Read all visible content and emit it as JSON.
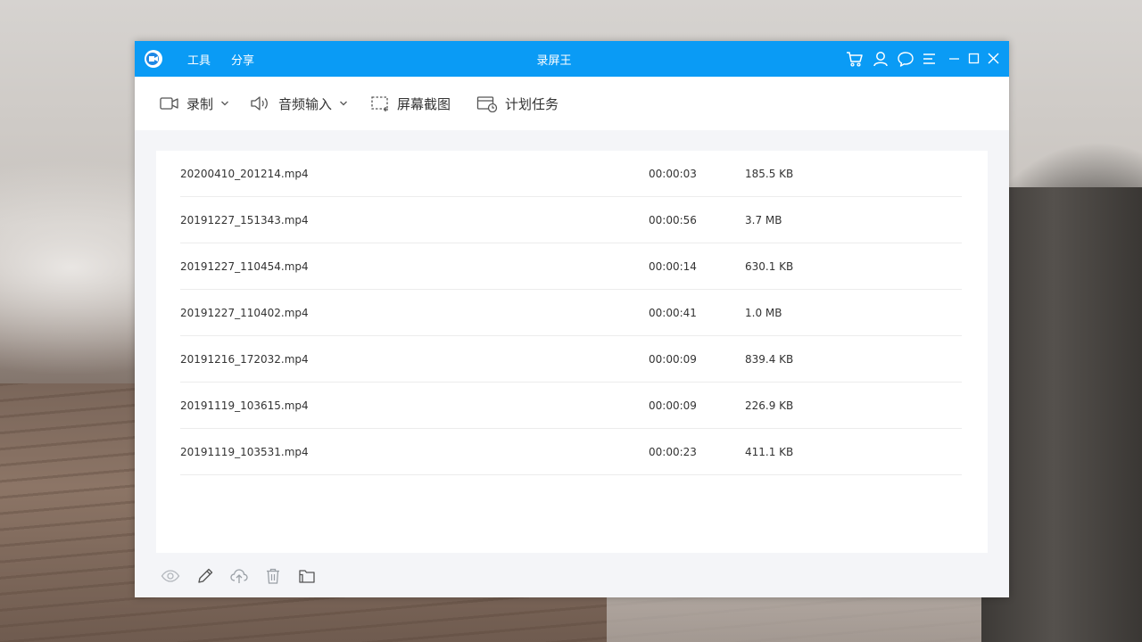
{
  "app": {
    "title": "录屏王",
    "menu": [
      "工具",
      "分享"
    ]
  },
  "titlebar_icons": [
    "cart-icon",
    "user-icon",
    "chat-icon",
    "menu-icon",
    "minimize-icon",
    "maximize-icon",
    "close-icon"
  ],
  "toolbar": {
    "record": {
      "label": "录制",
      "icon": "camera-icon",
      "has_dropdown": true
    },
    "audio_input": {
      "label": "音频输入",
      "icon": "speaker-icon",
      "has_dropdown": true
    },
    "screenshot": {
      "label": "屏幕截图",
      "icon": "screenshot-icon"
    },
    "schedule": {
      "label": "计划任务",
      "icon": "schedule-icon"
    }
  },
  "files": {
    "columns": [
      "name",
      "duration",
      "size"
    ],
    "rows": [
      {
        "name": "20200410_201214.mp4",
        "duration": "00:00:03",
        "size": "185.5 KB"
      },
      {
        "name": "20191227_151343.mp4",
        "duration": "00:00:56",
        "size": "3.7 MB"
      },
      {
        "name": "20191227_110454.mp4",
        "duration": "00:00:14",
        "size": "630.1 KB"
      },
      {
        "name": "20191227_110402.mp4",
        "duration": "00:00:41",
        "size": "1.0 MB"
      },
      {
        "name": "20191216_172032.mp4",
        "duration": "00:00:09",
        "size": "839.4 KB"
      },
      {
        "name": "20191119_103615.mp4",
        "duration": "00:00:09",
        "size": "226.9 KB"
      },
      {
        "name": "20191119_103531.mp4",
        "duration": "00:00:23",
        "size": "411.1 KB"
      }
    ]
  },
  "bottom_actions": [
    "preview-icon",
    "edit-icon",
    "upload-icon",
    "delete-icon",
    "open-folder-icon"
  ],
  "colors": {
    "titlebar": "#0a9bf5",
    "window_bg": "#f4f5f8",
    "text": "#333333",
    "icon_gray": "#8a8f96"
  }
}
